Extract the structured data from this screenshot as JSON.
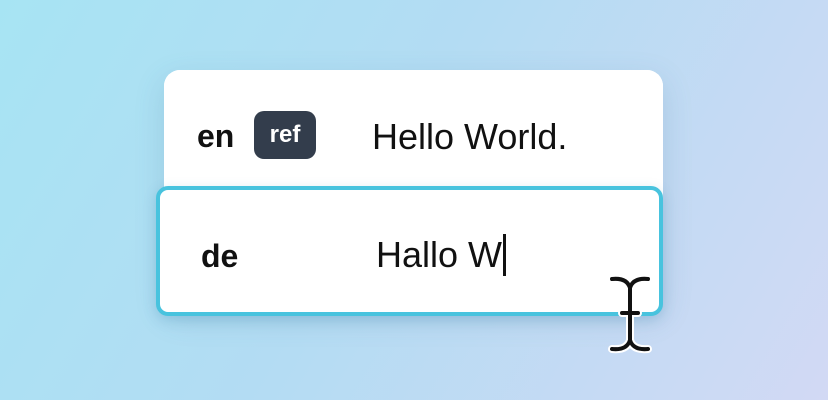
{
  "rows": [
    {
      "lang": "en",
      "badge": "ref",
      "text": "Hello World."
    },
    {
      "lang": "de",
      "text": "Hallo W"
    }
  ],
  "cursor": {
    "icon": "text-cursor-ibeam-icon"
  },
  "colors": {
    "focus_border": "#48c3de",
    "badge_bg": "#333d4c",
    "background_start": "#a7e4f3",
    "background_end": "#d2d9f4"
  }
}
